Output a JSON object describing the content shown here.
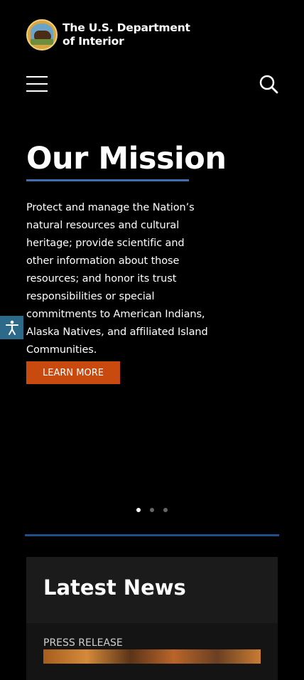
{
  "header": {
    "title_line1": "The U.S. Department",
    "title_line2": "of Interior"
  },
  "mission": {
    "title": "Our Mission",
    "text": "Protect and manage the Nation’s natural resources and cultural heritage; provide scientific and other information about those resources; and honor its trust responsibilities or special commitments to American Indians, Alaska Natives, and affiliated Island Communities.",
    "button": "LEARN MORE"
  },
  "carousel": {
    "slides": 3,
    "active_index": 0
  },
  "news": {
    "title": "Latest News",
    "card": {
      "category": "PRESS RELEASE"
    }
  },
  "colors": {
    "accent_blue": "#3d6fb2",
    "cta": "#c84a0f",
    "a11y": "#2d6a8a"
  }
}
